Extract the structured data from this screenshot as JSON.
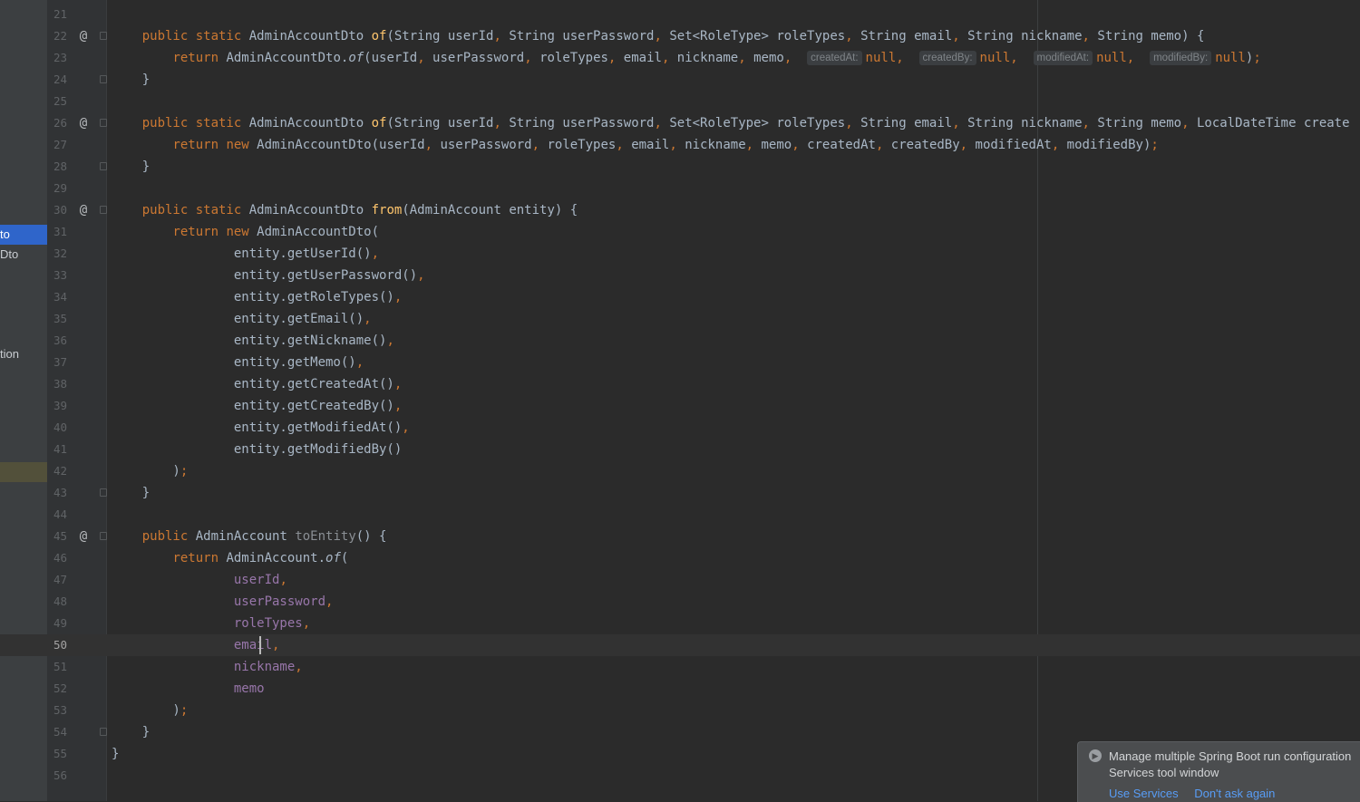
{
  "sidebar": {
    "items": [
      {
        "label": "to",
        "state": "selected"
      },
      {
        "label": "Dto",
        "state": ""
      },
      {
        "label": "",
        "state": ""
      },
      {
        "label": "tion",
        "state": ""
      },
      {
        "label": "",
        "state": "highlight"
      }
    ]
  },
  "editor": {
    "current_line": 50,
    "lines": [
      {
        "n": "21",
        "a": "",
        "f": false,
        "html": ""
      },
      {
        "n": "22",
        "a": "@",
        "f": true,
        "html": "    <span class='kw'>public static </span>AdminAccountDto <span class='fn'>of</span>(String userId<span class='kw'>, </span>String userPassword<span class='kw'>, </span>Set&lt;RoleType&gt; roleTypes<span class='kw'>, </span>String email<span class='kw'>, </span>String nickname<span class='kw'>, </span>String memo) {"
      },
      {
        "n": "23",
        "a": "",
        "f": false,
        "html": "        <span class='kw'>return </span>AdminAccountDto.<span class='it'>of</span>(userId<span class='kw'>, </span>userPassword<span class='kw'>, </span>roleTypes<span class='kw'>, </span>email<span class='kw'>, </span>nickname<span class='kw'>, </span>memo<span class='kw'>, </span> <span class='hint'>createdAt:</span><span class='kw'>null, </span> <span class='hint'>createdBy:</span><span class='kw'>null, </span> <span class='hint'>modifiedAt:</span><span class='kw'>null, </span> <span class='hint'>modifiedBy:</span><span class='kw'>null</span>)<span class='kw'>;</span>"
      },
      {
        "n": "24",
        "a": "",
        "f": true,
        "html": "    }"
      },
      {
        "n": "25",
        "a": "",
        "f": false,
        "html": ""
      },
      {
        "n": "26",
        "a": "@",
        "f": true,
        "html": "    <span class='kw'>public static </span>AdminAccountDto <span class='fn'>of</span>(String userId<span class='kw'>, </span>String userPassword<span class='kw'>, </span>Set&lt;RoleType&gt; roleTypes<span class='kw'>, </span>String email<span class='kw'>, </span>String nickname<span class='kw'>, </span>String memo<span class='kw'>, </span>LocalDateTime create"
      },
      {
        "n": "27",
        "a": "",
        "f": false,
        "html": "        <span class='kw'>return new </span>AdminAccountDto(userId<span class='kw'>, </span>userPassword<span class='kw'>, </span>roleTypes<span class='kw'>, </span>email<span class='kw'>, </span>nickname<span class='kw'>, </span>memo<span class='kw'>, </span>createdAt<span class='kw'>, </span>createdBy<span class='kw'>, </span>modifiedAt<span class='kw'>, </span>modifiedBy)<span class='kw'>;</span>"
      },
      {
        "n": "28",
        "a": "",
        "f": true,
        "html": "    }"
      },
      {
        "n": "29",
        "a": "",
        "f": false,
        "html": ""
      },
      {
        "n": "30",
        "a": "@",
        "f": true,
        "html": "    <span class='kw'>public static </span>AdminAccountDto <span class='fn'>from</span>(AdminAccount entity) {"
      },
      {
        "n": "31",
        "a": "",
        "f": false,
        "html": "        <span class='kw'>return new </span>AdminAccountDto("
      },
      {
        "n": "32",
        "a": "",
        "f": false,
        "html": "                entity.getUserId()<span class='kw'>,</span>"
      },
      {
        "n": "33",
        "a": "",
        "f": false,
        "html": "                entity.getUserPassword()<span class='kw'>,</span>"
      },
      {
        "n": "34",
        "a": "",
        "f": false,
        "html": "                entity.getRoleTypes()<span class='kw'>,</span>"
      },
      {
        "n": "35",
        "a": "",
        "f": false,
        "html": "                entity.getEmail()<span class='kw'>,</span>"
      },
      {
        "n": "36",
        "a": "",
        "f": false,
        "html": "                entity.getNickname()<span class='kw'>,</span>"
      },
      {
        "n": "37",
        "a": "",
        "f": false,
        "html": "                entity.getMemo()<span class='kw'>,</span>"
      },
      {
        "n": "38",
        "a": "",
        "f": false,
        "html": "                entity.getCreatedAt()<span class='kw'>,</span>"
      },
      {
        "n": "39",
        "a": "",
        "f": false,
        "html": "                entity.getCreatedBy()<span class='kw'>,</span>"
      },
      {
        "n": "40",
        "a": "",
        "f": false,
        "html": "                entity.getModifiedAt()<span class='kw'>,</span>"
      },
      {
        "n": "41",
        "a": "",
        "f": false,
        "html": "                entity.getModifiedBy()"
      },
      {
        "n": "42",
        "a": "",
        "f": false,
        "html": "        )<span class='kw'>;</span>"
      },
      {
        "n": "43",
        "a": "",
        "f": true,
        "html": "    }"
      },
      {
        "n": "44",
        "a": "",
        "f": false,
        "html": ""
      },
      {
        "n": "45",
        "a": "@",
        "f": true,
        "html": "    <span class='kw'>public </span>AdminAccount <span class='unused'>toEntity</span>() {"
      },
      {
        "n": "46",
        "a": "",
        "f": false,
        "html": "        <span class='kw'>return </span>AdminAccount.<span class='it'>of</span>("
      },
      {
        "n": "47",
        "a": "",
        "f": false,
        "html": "                <span class='fld'>userId</span><span class='kw'>,</span>"
      },
      {
        "n": "48",
        "a": "",
        "f": false,
        "html": "                <span class='fld'>userPassword</span><span class='kw'>,</span>"
      },
      {
        "n": "49",
        "a": "",
        "f": false,
        "html": "                <span class='fld'>roleTypes</span><span class='kw'>,</span>"
      },
      {
        "n": "50",
        "a": "",
        "f": false,
        "html": "                <span class='fld'>email</span><span class='kw'>,</span>"
      },
      {
        "n": "51",
        "a": "",
        "f": false,
        "html": "                <span class='fld'>nickname</span><span class='kw'>,</span>"
      },
      {
        "n": "52",
        "a": "",
        "f": false,
        "html": "                <span class='fld'>memo</span>"
      },
      {
        "n": "53",
        "a": "",
        "f": false,
        "html": "        )<span class='kw'>;</span>"
      },
      {
        "n": "54",
        "a": "",
        "f": true,
        "html": "    }"
      },
      {
        "n": "55",
        "a": "",
        "f": false,
        "html": "}"
      },
      {
        "n": "56",
        "a": "",
        "f": false,
        "html": ""
      }
    ]
  },
  "notification": {
    "icon": "info-icon",
    "line1": "Manage multiple Spring Boot run configuration",
    "line2": "Services tool window",
    "use_services": "Use Services",
    "dont_ask": "Don't ask again"
  },
  "colors": {
    "background": "#2b2b2b",
    "keyword": "#cc7832",
    "method": "#ffc66d",
    "field": "#9876aa",
    "text": "#a9b7c6",
    "link": "#589df6"
  }
}
